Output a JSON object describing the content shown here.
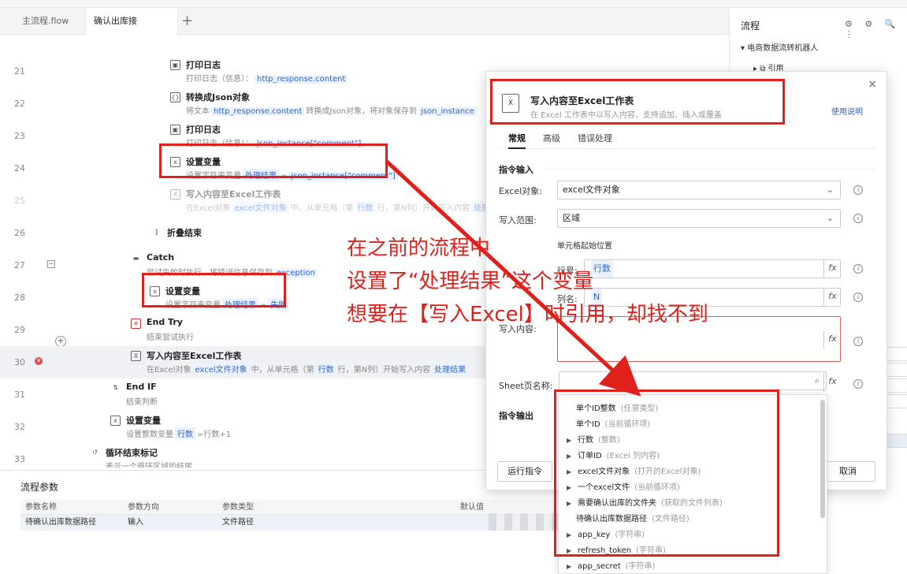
{
  "tabs": [
    {
      "label": "主流程.flow"
    },
    {
      "label": "确认出库接口.flow",
      "close": "×"
    }
  ],
  "plus": "+",
  "rows": [
    {
      "num": "21",
      "title": "打印日志",
      "desc_pre": "打印日志（信息）：",
      "chip": "http_response.content"
    },
    {
      "num": "22",
      "title": "转换成Json对象",
      "desc_pre": "将文本",
      "chip": "http_response.content",
      "desc_mid": "转换成Json对象，将对象保存到",
      "chip2": "json_instance"
    },
    {
      "num": "23",
      "title": "打印日志",
      "desc_pre": "打印日志（信息）：",
      "chip": "json_instance[\"comment\"]"
    },
    {
      "num": "24",
      "title": "设置变量",
      "desc_pre": "设置字符串变量",
      "chip": "处理结果",
      "desc_mid": "=",
      "chip2": "json_instance[\"comment\"]"
    },
    {
      "num": "25",
      "title": "写入内容至Excel工作表",
      "desc_pre": "在Excel对象",
      "chip": "excel文件对象",
      "desc_mid": "中，从单元格（第",
      "chip2": "行数",
      "desc_end": "行，第N列）开始写入内容",
      "chip3": "处理结果"
    },
    {
      "num": "26",
      "title": "折叠结束"
    },
    {
      "num": "27",
      "title": "Catch",
      "desc_pre": "尝试失败时执行，将错误信息保存到",
      "chip": "exception",
      "fold": "−"
    },
    {
      "num": "28",
      "title": "设置变量",
      "desc_pre": "设置字符串变量",
      "chip": "处理结果",
      "desc_mid": "=",
      "chip2": "失败"
    },
    {
      "num": "29",
      "title": "End Try",
      "desc_pre": "结束尝试执行"
    },
    {
      "num": "30",
      "title": "写入内容至Excel工作表",
      "desc_pre": "在Excel对象",
      "chip": "excel文件对象",
      "desc_mid": "中，从单元格（第",
      "chip2": "行数",
      "desc_end": "行，第N列）开始写入内容",
      "chip3": "处理结果",
      "err": "✕"
    },
    {
      "num": "31",
      "title": "End IF",
      "desc_pre": "结束判断"
    },
    {
      "num": "32",
      "title": "设置变量",
      "desc_pre": "设置整数变量",
      "chip": "行数",
      "desc_mid": "=行数+1"
    },
    {
      "num": "33",
      "title": "循环结束标记",
      "desc_pre": "表示一个循环区域的结尾"
    }
  ],
  "params": {
    "title": "流程参数",
    "headers": [
      "参数名称",
      "参数方向",
      "参数类型",
      "默认值"
    ],
    "row": [
      "待确认出库数据路径",
      "输入",
      "文件路径"
    ]
  },
  "right": {
    "title": "流程",
    "icons": "⚙ ⚙ 🔍 ⋮",
    "tree1": "▾ 电商数据流转机器人",
    "tree2": "▸ ⧉ 引用"
  },
  "dialog": {
    "title": "写入内容至Excel工作表",
    "subtitle": "在 Excel 工作表中以写入内容，支持追加、插入或覆盖",
    "help": "使用说明",
    "close": "×",
    "tabs": [
      "常规",
      "高级",
      "错误处理"
    ],
    "sec_input": "指令输入",
    "excel_label": "Excel对象:",
    "excel_value": "excel文件对象",
    "range_label": "写入范围:",
    "range_value": "区域",
    "cell_label": "单元格起始位置",
    "row_label": "行号:",
    "row_chip": "行数",
    "col_label": "列名:",
    "col_chip": "N",
    "content_label": "写入内容:",
    "sheet_label": "Sheet页名称:",
    "sec_output": "指令输出",
    "run": "运行指令",
    "cancel": "取消",
    "fx": "fx",
    "info": "i"
  },
  "popup": [
    {
      "name": "单个ID整数",
      "type": "(任意类型)",
      "arrow": ""
    },
    {
      "name": "单个ID",
      "type": "(当前循环项)",
      "arrow": ""
    },
    {
      "name": "行数",
      "type": "(整数)",
      "arrow": "▶"
    },
    {
      "name": "订单ID",
      "type": "(Excel  列内容)",
      "arrow": "▶"
    },
    {
      "name": "excel文件对象",
      "type": "(打开的Excel对象)",
      "arrow": "▶"
    },
    {
      "name": "一个excel文件",
      "type": "(当前循环项)",
      "arrow": "▶"
    },
    {
      "name": "需要确认出库的文件夹",
      "type": "(获取的文件列表)",
      "arrow": "▶"
    },
    {
      "name": "待确认出库数据路径",
      "type": "(文件路径)",
      "arrow": ""
    },
    {
      "name": "app_key",
      "type": "(字符串)",
      "arrow": "▶"
    },
    {
      "name": "refresh_token",
      "type": "(字符串)",
      "arrow": "▶"
    },
    {
      "name": "app_secret",
      "type": "(字符串)",
      "arrow": "▶"
    }
  ],
  "annotation": {
    "line1": "在之前的流程中",
    "line2": "设置了“处理结果”这个变量",
    "line3": "想要在【写入Excel】时引用，却找不到"
  },
  "colors": {
    "accent": "#2a66d8",
    "annotation_red": "#e0201a"
  }
}
